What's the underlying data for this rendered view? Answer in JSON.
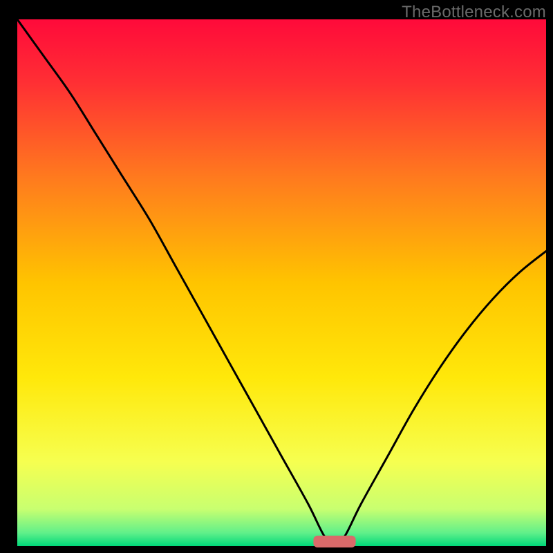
{
  "watermark": "TheBottleneck.com",
  "chart_data": {
    "type": "line",
    "title": "",
    "xlabel": "",
    "ylabel": "",
    "xlim": [
      0,
      100
    ],
    "ylim": [
      0,
      100
    ],
    "x": [
      0,
      5,
      10,
      15,
      20,
      25,
      30,
      35,
      40,
      45,
      50,
      55,
      58,
      60,
      62,
      65,
      70,
      75,
      80,
      85,
      90,
      95,
      100
    ],
    "values": [
      100,
      93,
      86,
      78,
      70,
      62,
      53,
      44,
      35,
      26,
      17,
      8,
      2,
      0,
      2,
      8,
      17,
      26,
      34,
      41,
      47,
      52,
      56
    ],
    "optimum_x": 60,
    "optimum_band": {
      "x_start": 56,
      "x_end": 64,
      "height_pct": 1.2
    },
    "gradient_stops": [
      {
        "offset": 0.0,
        "color": "#ff0a3a"
      },
      {
        "offset": 0.12,
        "color": "#ff2f34"
      },
      {
        "offset": 0.3,
        "color": "#ff7a1e"
      },
      {
        "offset": 0.5,
        "color": "#ffc400"
      },
      {
        "offset": 0.68,
        "color": "#ffe80a"
      },
      {
        "offset": 0.84,
        "color": "#f6ff50"
      },
      {
        "offset": 0.93,
        "color": "#c8ff70"
      },
      {
        "offset": 0.975,
        "color": "#60f08a"
      },
      {
        "offset": 1.0,
        "color": "#00d87a"
      }
    ],
    "marker_color": "#d96a6a"
  }
}
